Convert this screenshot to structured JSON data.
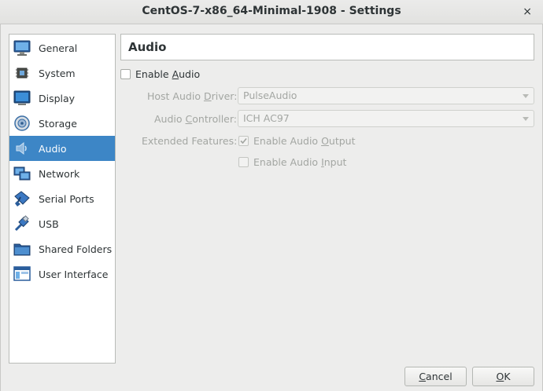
{
  "window": {
    "title": "CentOS-7-x86_64-Minimal-1908 - Settings",
    "close_glyph": "×"
  },
  "sidebar": {
    "items": [
      {
        "label": "General",
        "icon": "general-icon"
      },
      {
        "label": "System",
        "icon": "system-icon"
      },
      {
        "label": "Display",
        "icon": "display-icon"
      },
      {
        "label": "Storage",
        "icon": "storage-icon"
      },
      {
        "label": "Audio",
        "icon": "audio-icon",
        "selected": true
      },
      {
        "label": "Network",
        "icon": "network-icon"
      },
      {
        "label": "Serial Ports",
        "icon": "serial-ports-icon"
      },
      {
        "label": "USB",
        "icon": "usb-icon"
      },
      {
        "label": "Shared Folders",
        "icon": "shared-folders-icon"
      },
      {
        "label": "User Interface",
        "icon": "user-interface-icon"
      }
    ]
  },
  "page": {
    "title": "Audio",
    "enable_audio": {
      "pre": "Enable ",
      "key": "A",
      "post": "udio",
      "checked": false
    },
    "host_driver": {
      "pre": "Host Audio ",
      "key": "D",
      "post": "river:",
      "value": "PulseAudio"
    },
    "controller": {
      "pre": "Audio ",
      "key": "C",
      "post": "ontroller:",
      "value": "ICH AC97"
    },
    "extended_label": "Extended Features:",
    "enable_output": {
      "pre": "Enable Audio ",
      "key": "O",
      "post": "utput",
      "checked": true
    },
    "enable_input": {
      "pre": "Enable Audio ",
      "key": "I",
      "post": "nput",
      "checked": false
    }
  },
  "buttons": {
    "cancel": {
      "key": "C",
      "post": "ancel"
    },
    "ok": {
      "key": "O",
      "post": "K"
    }
  },
  "colors": {
    "accent": "#3d86c6",
    "disabled_text": "#a3a6a2"
  }
}
